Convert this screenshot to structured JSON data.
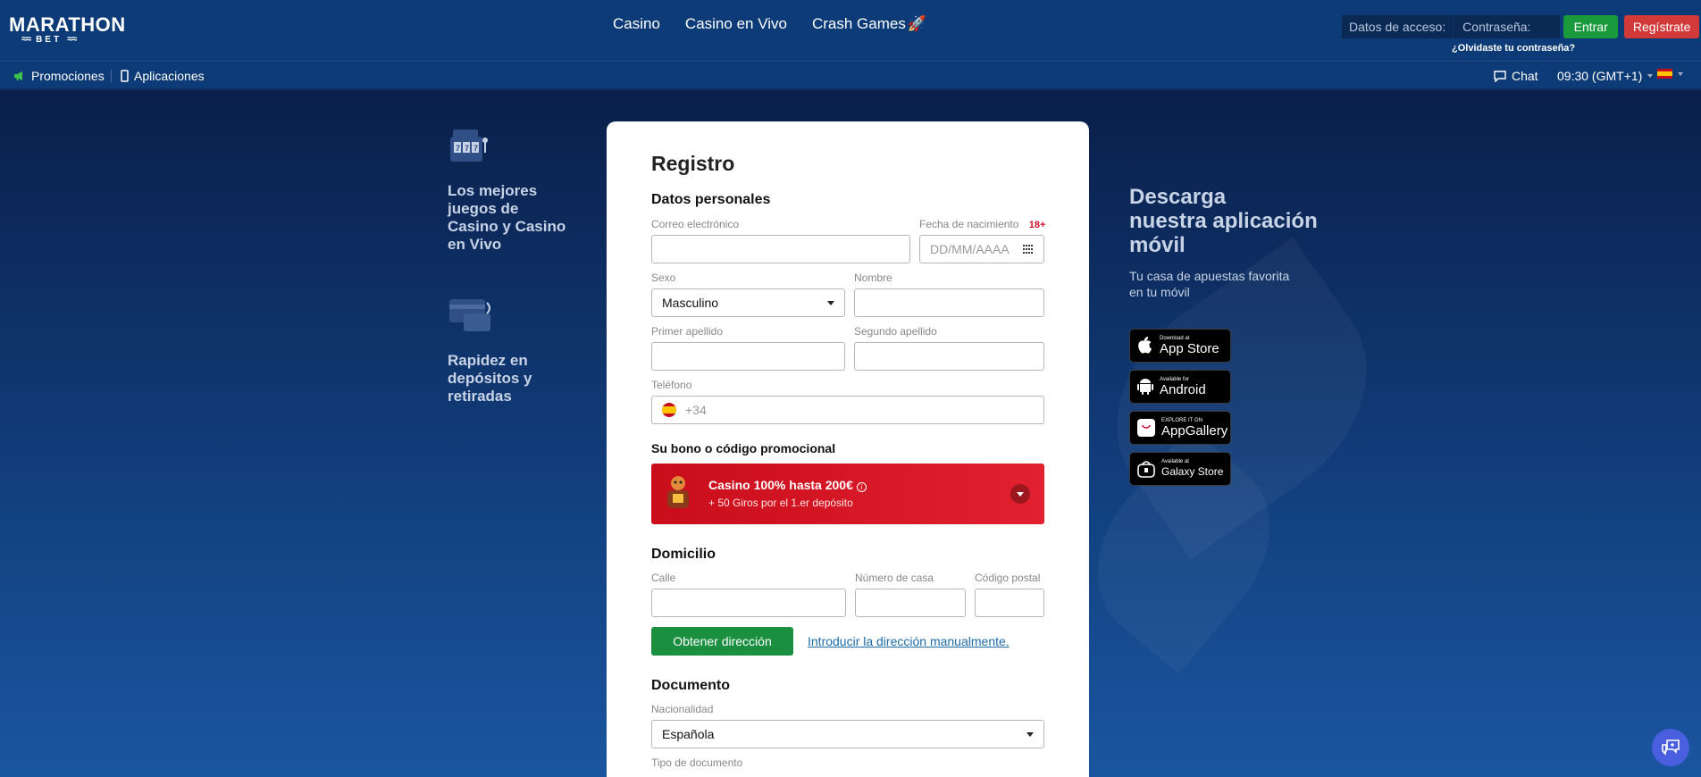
{
  "brand": {
    "name": "MARATHON",
    "sub": "BET"
  },
  "nav": {
    "items": [
      "Casino",
      "Casino en Vivo",
      "Crash Games"
    ]
  },
  "login": {
    "label": "Datos de acceso:",
    "password_placeholder": "Contraseña:",
    "enter": "Entrar",
    "register": "Regístrate",
    "forgot": "¿Olvidaste tu contraseña?"
  },
  "subnav": {
    "promotions": "Promociones",
    "apps": "Aplicaciones",
    "chat": "Chat",
    "time": "09:30 (GMT+1)"
  },
  "features": [
    {
      "text": "Los mejores juegos de Casino y Casino en Vivo",
      "icon": "slot-machine-icon"
    },
    {
      "text": "Rapidez en depósitos y retiradas",
      "icon": "cards-icon"
    }
  ],
  "form": {
    "title": "Registro",
    "personal": {
      "heading": "Datos personales",
      "email_label": "Correo electrónico",
      "birth_label": "Fecha de nacimiento",
      "age_badge": "18+",
      "birth_placeholder": "DD/MM/AAAA",
      "sex_label": "Sexo",
      "sex_value": "Masculino",
      "name_label": "Nombre",
      "surname1_label": "Primer apellido",
      "surname2_label": "Segundo apellido",
      "phone_label": "Teléfono",
      "phone_prefix": "+34"
    },
    "bonus": {
      "heading": "Su bono o código promocional",
      "title": "Casino 100% hasta 200€",
      "subtitle": "+ 50 Giros por el 1.er depósito"
    },
    "address": {
      "heading": "Domicilio",
      "street_label": "Calle",
      "house_label": "Número de casa",
      "zip_label": "Código postal",
      "get_address": "Obtener dirección",
      "manual": "Introducir la dirección manualmente."
    },
    "document": {
      "heading": "Documento",
      "nationality_label": "Nacionalidad",
      "nationality_value": "Española",
      "doc_type_label": "Tipo de documento"
    }
  },
  "download": {
    "title": "Descarga\nnuestra aplicación\nmóvil",
    "subtitle": "Tu casa de apuestas favorita\nen tu móvil",
    "stores": [
      {
        "small": "Download at",
        "big": "App Store",
        "icon": "apple-icon"
      },
      {
        "small": "Available for",
        "big": "Android",
        "icon": "android-icon"
      },
      {
        "small": "EXPLORE IT ON",
        "big": "AppGallery",
        "icon": "huawei-icon"
      },
      {
        "small": "Available at",
        "big": "Galaxy Store",
        "icon": "galaxy-store-icon"
      }
    ]
  },
  "colors": {
    "header": "#0c3b77",
    "green": "#1a9a3c",
    "red": "#d23a3a",
    "bonus_red": "#d4111f"
  }
}
